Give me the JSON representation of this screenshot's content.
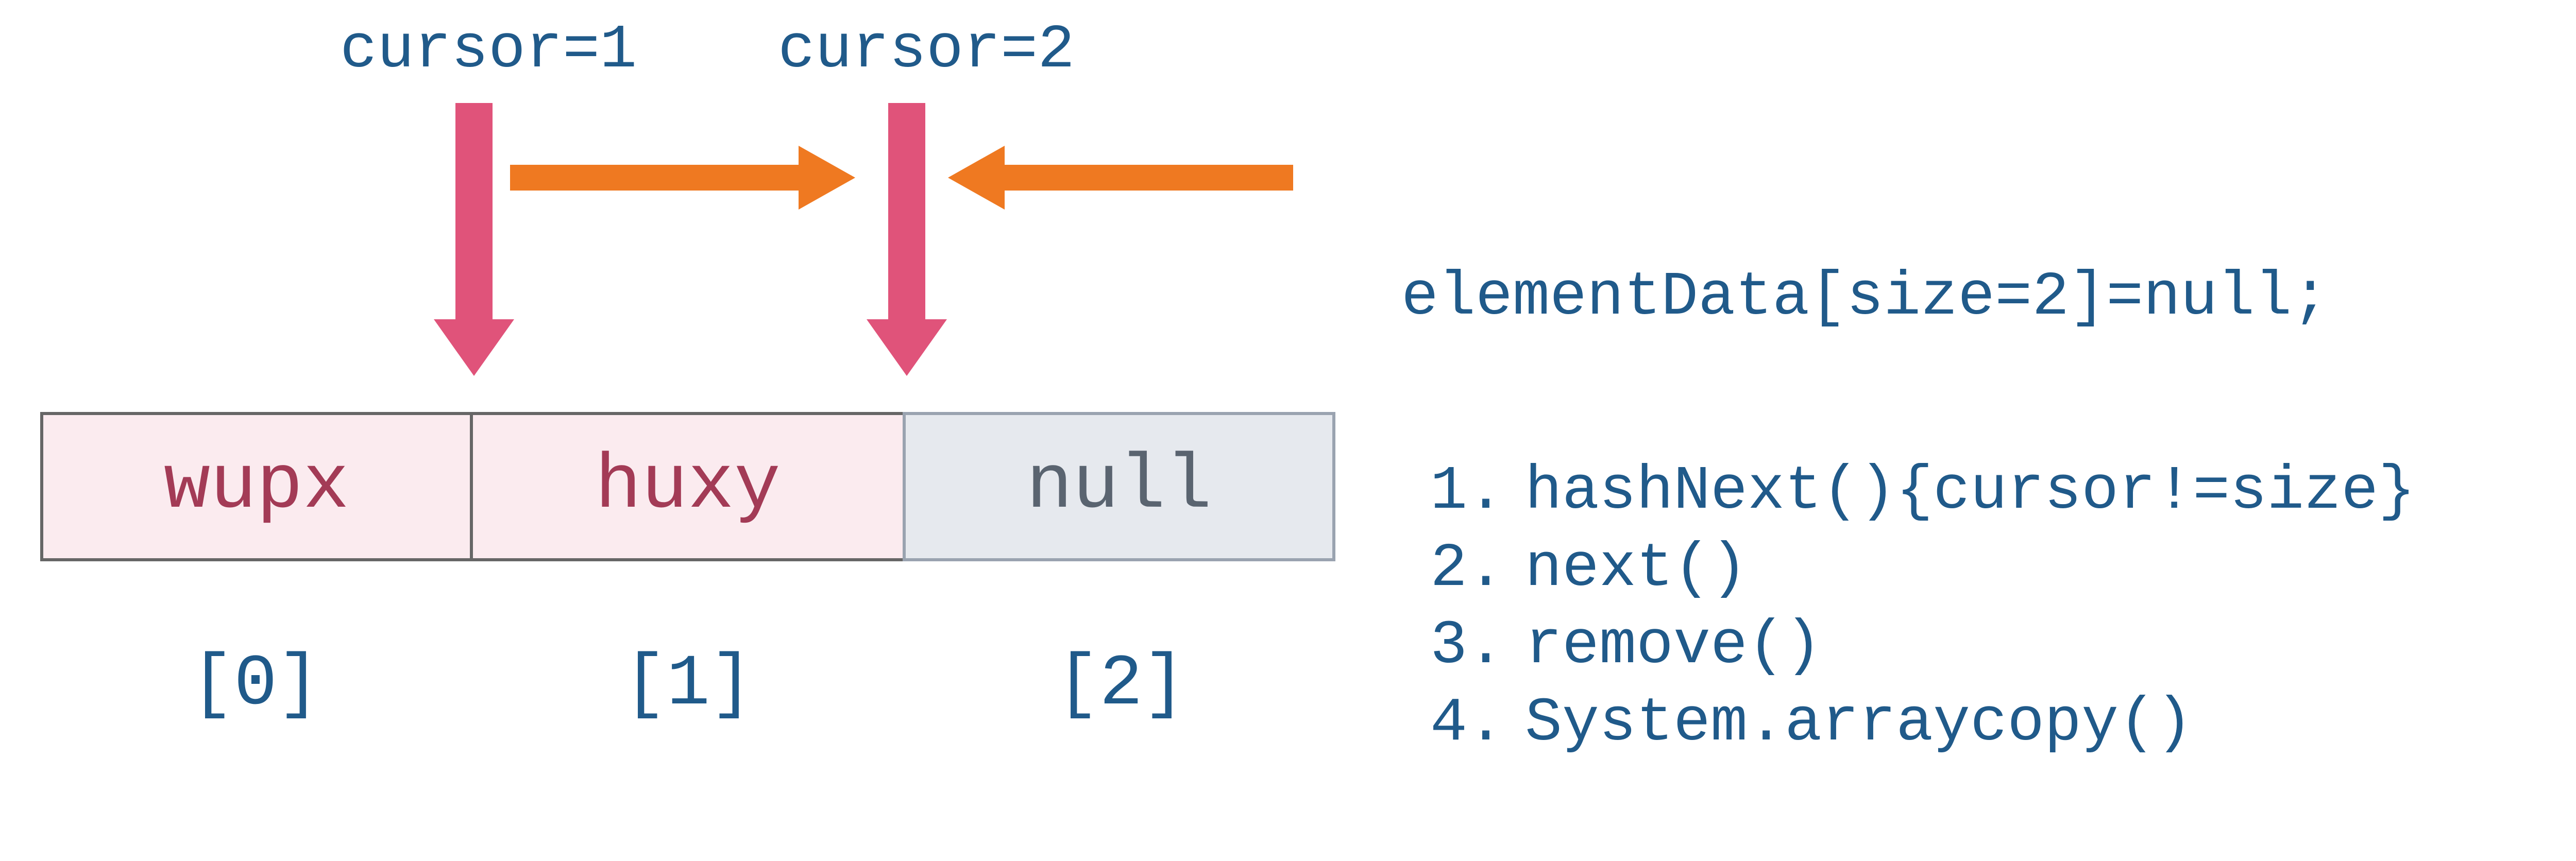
{
  "cursor1_label": "cursor=1",
  "cursor2_label": "cursor=2",
  "cells": {
    "0": "wupx",
    "1": "huxy",
    "2": "null"
  },
  "indices": {
    "0": "[0]",
    "1": "[1]",
    "2": "[2]"
  },
  "side_stmt": "elementData[size=2]=null;",
  "steps": {
    "1": {
      "num": "1.",
      "text": "hashNext(){cursor!=size}"
    },
    "2": {
      "num": "2.",
      "text": "next()"
    },
    "3": {
      "num": "3.",
      "text": "remove()"
    },
    "4": {
      "num": "4.",
      "text": "System.arraycopy()"
    }
  }
}
